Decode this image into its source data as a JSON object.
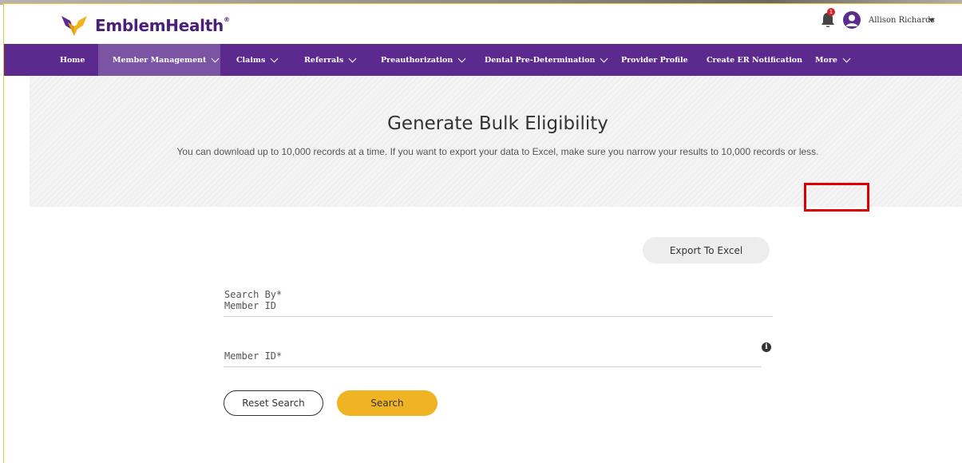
{
  "brand": {
    "name": "EmblemHealth",
    "registered_mark": "®",
    "purple": "#5c2a8e",
    "gold": "#f0b323"
  },
  "header": {
    "notification_count": "1",
    "user_name": "Allison Richards"
  },
  "nav": {
    "items": [
      {
        "label": "Home",
        "has_dropdown": false
      },
      {
        "label": "Member Management",
        "has_dropdown": true,
        "active": true
      },
      {
        "label": "Claims",
        "has_dropdown": true
      },
      {
        "label": "Referrals",
        "has_dropdown": true
      },
      {
        "label": "Preauthorization",
        "has_dropdown": true
      },
      {
        "label": "Dental Pre-Determination",
        "has_dropdown": true
      },
      {
        "label": "Provider Profile",
        "has_dropdown": false
      },
      {
        "label": "Create ER Notification",
        "has_dropdown": false
      },
      {
        "label": "More",
        "has_dropdown": true
      }
    ]
  },
  "hero": {
    "title": "Generate Bulk Eligibility",
    "subtitle": "You can download up to 10,000 records at a time. If you want to export your data to Excel, make sure you narrow your results to 10,000 records or less."
  },
  "form": {
    "export_label": "Export To Excel",
    "search_by_label": "Search By*",
    "search_by_value": "Member ID",
    "member_id_label": "Member ID*",
    "info_icon_glyph": "i",
    "reset_label": "Reset Search",
    "search_label": "Search"
  },
  "annotation": {
    "highlight_color": "#e00000"
  }
}
